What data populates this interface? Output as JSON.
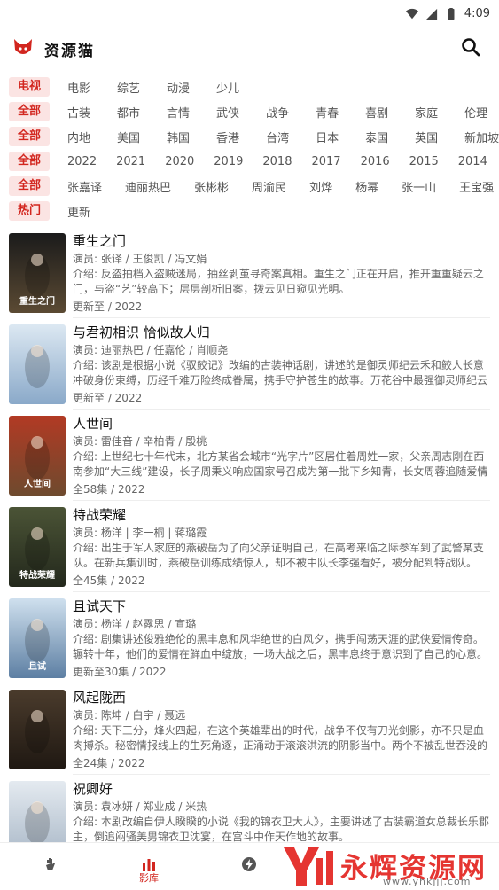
{
  "status_bar": {
    "time": "4:09"
  },
  "app_bar": {
    "title": "资源猫"
  },
  "filters": [
    {
      "head": "电视",
      "options": [
        "电影",
        "综艺",
        "动漫",
        "少儿"
      ]
    },
    {
      "head": "全部",
      "options": [
        "古装",
        "都市",
        "言情",
        "武侠",
        "战争",
        "青春",
        "喜剧",
        "家庭",
        "伦理"
      ]
    },
    {
      "head": "全部",
      "options": [
        "内地",
        "美国",
        "韩国",
        "香港",
        "台湾",
        "日本",
        "泰国",
        "英国",
        "新加坡"
      ]
    },
    {
      "head": "全部",
      "options": [
        "2022",
        "2021",
        "2020",
        "2019",
        "2018",
        "2017",
        "2016",
        "2015",
        "2014"
      ]
    },
    {
      "head": "全部",
      "options": [
        "张嘉译",
        "迪丽热巴",
        "张彬彬",
        "周渝民",
        "刘烨",
        "杨幂",
        "张一山",
        "王宝强"
      ]
    },
    {
      "head": "热门",
      "options": [
        "更新"
      ]
    }
  ],
  "movies": [
    {
      "title": "重生之门",
      "cast": "演员: 张译 / 王俊凯 / 冯文娟",
      "intro": "介绍: 反盗拍档入盗贼迷局，抽丝剥茧寻奇案真相。重生之门正在开启，推开重重疑云之门，与盗“艺”较高下；层层剖析旧案，拨云见日窥见光明。",
      "status": "更新至 / 2022",
      "poster_text": "重生之门",
      "colors": [
        "#1b1b1b",
        "#5b4a33"
      ]
    },
    {
      "title": "与君初相识 恰似故人归",
      "cast": "演员: 迪丽热巴 / 任嘉伦 / 肖顺尧",
      "intro": "介绍: 该剧是根据小说《驭鲛记》改编的古装神话剧，讲述的是御灵师纪云禾和鲛人长意冲破身份束缚，历经千难万险终成眷属，携手守护苍生的故事。万花谷中最强御灵师纪云禾的故事。",
      "status": "更新至 / 2022",
      "poster_text": "",
      "colors": [
        "#dce8f2",
        "#8aa9c9"
      ]
    },
    {
      "title": "人世间",
      "cast": "演员: 雷佳音 / 辛柏青 / 殷桃",
      "intro": "介绍: 上世纪七十年代末，北方某省会城市“光字片”区居住着周姓一家，父亲周志刚在西南参加“大三线”建设，长子周秉义响应国家号召成为第一批下乡知青，长女周蓉追随爱情远赴贵州。",
      "status": "全58集 / 2022",
      "poster_text": "人世间",
      "colors": [
        "#b23a24",
        "#6e4a2e"
      ]
    },
    {
      "title": "特战荣耀",
      "cast": "演员: 杨洋   |   李一桐   |   蒋璐霞",
      "intro": "介绍: 出生于军人家庭的燕破岳为了向父亲证明自己，在高考来临之际参军到了武警某支队。在新兵集训时，燕破岳训练成绩惊人，却不被中队长李强看好，被分配到特战队。",
      "status": "全45集 / 2022",
      "poster_text": "特战荣耀",
      "colors": [
        "#4b5436",
        "#23281c"
      ]
    },
    {
      "title": "且试天下",
      "cast": "演员: 杨洋 / 赵露思 / 宣璐",
      "intro": "介绍: 剧集讲述俊雅绝伦的黑丰息和风华绝世的白风夕，携手闯荡天涯的武侠爱情传奇。辗转十年，他们的爱情在鲜血中绽放，一场大战之后，黑丰息终于意识到了自己的心意。",
      "status": "更新至30集 / 2022",
      "poster_text": "且试",
      "colors": [
        "#cfe0ee",
        "#5d7fa3"
      ]
    },
    {
      "title": "风起陇西",
      "cast": "演员: 陈坤 / 白宇 / 聂远",
      "intro": "介绍: 天下三分，烽火四起，在这个英雄辈出的时代，战争不仅有刀光剑影，亦不只是血肉搏杀。秘密情报线上的生死角逐，正涌动于滚滚洪流的阴影当中。两个不被乱世吞没的人。",
      "status": "全24集 / 2022",
      "poster_text": "",
      "colors": [
        "#4a3b2c",
        "#1f1812"
      ]
    },
    {
      "title": "祝卿好",
      "cast": "演员: 袁冰妍 / 郑业成 / 米热",
      "intro": "介绍: 本剧改编自伊人睽睽的小说《我的锦衣卫大人》，主要讲述了古装霸道女总裁长乐郡主，倒追闷骚美男锦衣卫沈宴，在宫斗中作天作地的故事。",
      "status": "",
      "poster_text": "",
      "colors": [
        "#e4eaf0",
        "#a7b6c6"
      ]
    }
  ],
  "bottom_nav": [
    {
      "label": "",
      "icon": "hand-icon"
    },
    {
      "label": "影库",
      "icon": "bar-chart-icon"
    },
    {
      "label": "",
      "icon": "lightning-icon"
    }
  ],
  "watermark": {
    "text": "永辉资源网",
    "url": "www.yhkjjj.com"
  }
}
